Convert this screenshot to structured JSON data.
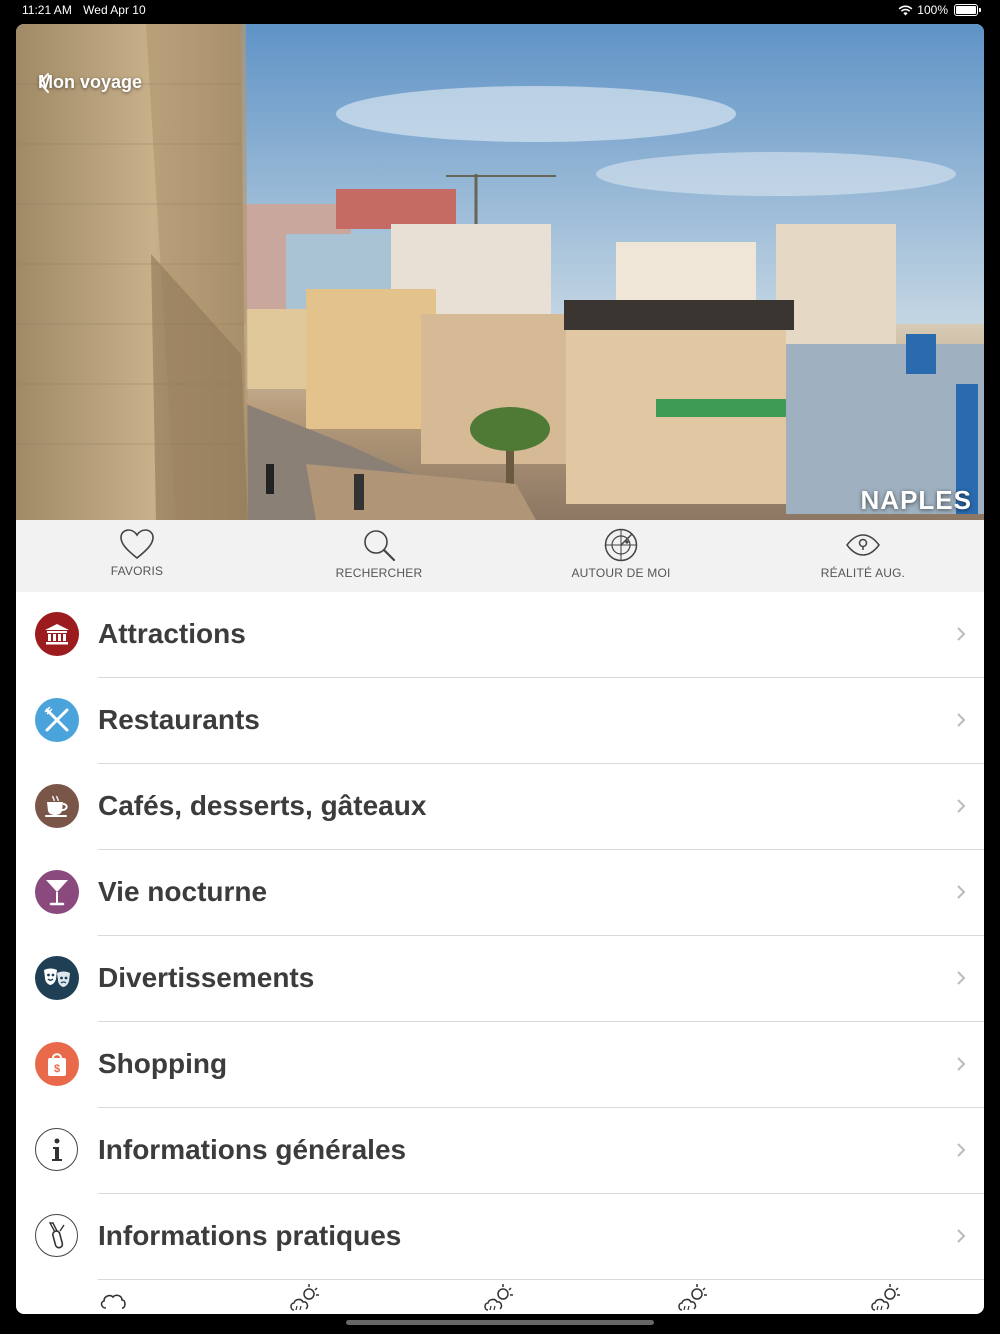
{
  "status": {
    "time": "11:21 AM",
    "date": "Wed Apr 10",
    "battery": "100%"
  },
  "header": {
    "back_label": "Mon voyage",
    "city": "NAPLES"
  },
  "toolbar": [
    {
      "label": "FAVORIS",
      "icon": "heart-icon"
    },
    {
      "label": "RECHERCHER",
      "icon": "search-icon"
    },
    {
      "label": "AUTOUR DE MOI",
      "icon": "radar-icon"
    },
    {
      "label": "RÉALITÉ AUG.",
      "icon": "eye-icon"
    }
  ],
  "categories": [
    {
      "label": "Attractions",
      "icon": "museum-icon",
      "color": "#9b1b1f"
    },
    {
      "label": "Restaurants",
      "icon": "fork-knife-icon",
      "color": "#4ba3dc"
    },
    {
      "label": "Cafés, desserts, gâteaux",
      "icon": "coffee-cup-icon",
      "color": "#7a5649"
    },
    {
      "label": "Vie nocturne",
      "icon": "cocktail-icon",
      "color": "#8a4a7e"
    },
    {
      "label": "Divertissements",
      "icon": "theater-masks-icon",
      "color": "#1f3f55"
    },
    {
      "label": "Shopping",
      "icon": "shopping-bag-icon",
      "color": "#e96a4a"
    },
    {
      "label": "Informations générales",
      "icon": "info-icon",
      "color": "#ffffff"
    },
    {
      "label": "Informations pratiques",
      "icon": "swiss-knife-icon",
      "color": "#ffffff"
    }
  ],
  "weather": [
    {
      "icon": "cloud-icon"
    },
    {
      "icon": "sun-rain-icon"
    },
    {
      "icon": "sun-rain-icon"
    },
    {
      "icon": "sun-rain-icon"
    },
    {
      "icon": "sun-rain-icon"
    }
  ]
}
